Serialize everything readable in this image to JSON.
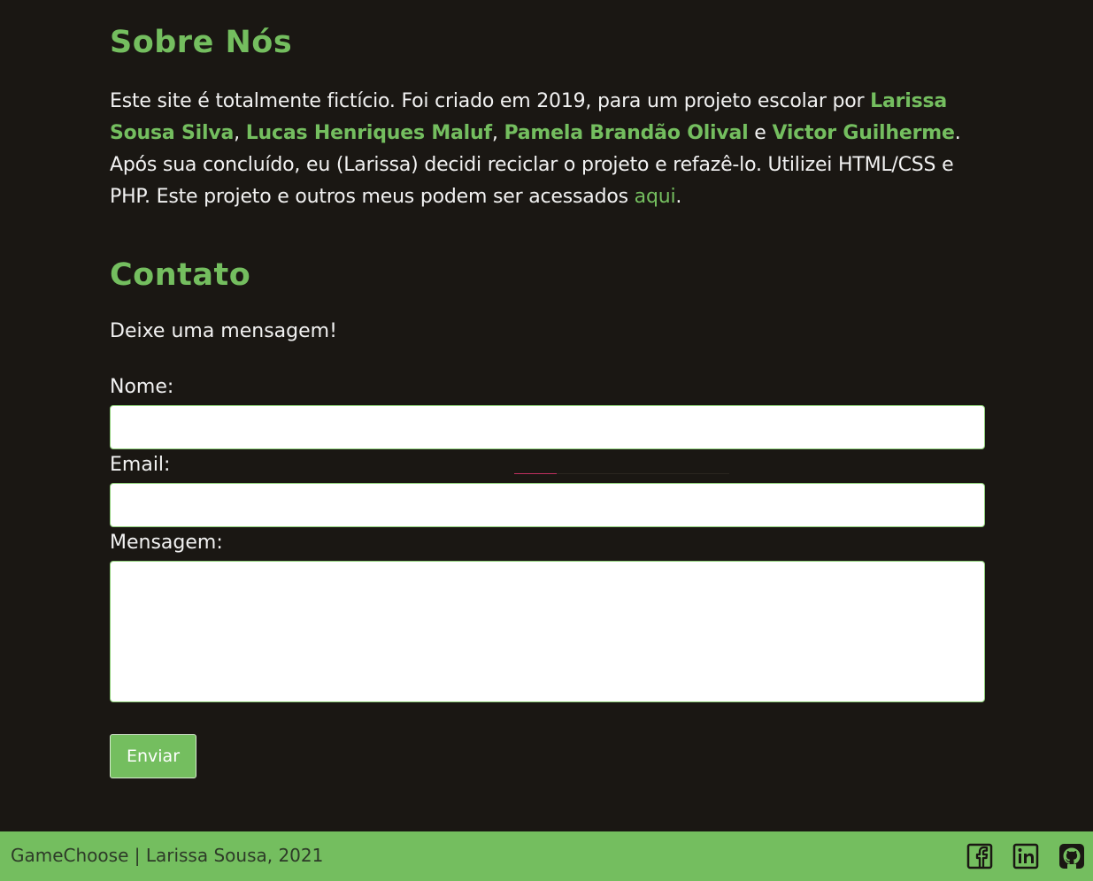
{
  "about": {
    "title": "Sobre Nós",
    "text_1": "Este site é totalmente fictício. Foi criado em 2019, para um projeto escolar por ",
    "name_1": "Larissa Sousa Silva",
    "sep_1": ", ",
    "name_2": "Lucas Henriques Maluf",
    "sep_2": ", ",
    "name_3": "Pamela Brandão Olival",
    "sep_3": " e ",
    "name_4": "Victor Guilherme",
    "text_2": ". Após sua concluído, eu (Larissa) decidi reciclar o projeto e refazê-lo. Utilizei HTML/CSS e PHP. Este projeto e outros meus podem ser acessados ",
    "link_label": "aqui",
    "text_3": "."
  },
  "contact": {
    "title": "Contato",
    "intro": "Deixe uma mensagem!",
    "name_label": "Nome:",
    "name_value": "",
    "email_label": "Email:",
    "email_value": "",
    "message_label": "Mensagem:",
    "message_value": "",
    "submit_label": "Enviar"
  },
  "footer": {
    "text": "GameChoose | Larissa Sousa, 2021",
    "icons": [
      "facebook-icon",
      "linkedin-icon",
      "github-icon"
    ]
  },
  "colors": {
    "background": "#1a1713",
    "accent": "#74be5f",
    "text": "#f2f2f2",
    "footer_text": "#2d3a28"
  }
}
